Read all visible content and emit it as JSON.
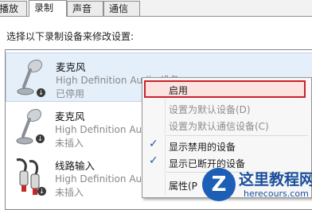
{
  "tabs": [
    {
      "label": "播放"
    },
    {
      "label": "录制"
    },
    {
      "label": "声音"
    },
    {
      "label": "通信"
    }
  ],
  "instruction": "选择以下录制设备来修改设置:",
  "devices": [
    {
      "name": "麦克风",
      "description": "High Definition Audio 设备",
      "status": "已停用",
      "icon": "microphone-icon"
    },
    {
      "name": "麦克风",
      "description": "High Definition Audio 设备",
      "status": "未插入",
      "icon": "microphone-icon"
    },
    {
      "name": "线路输入",
      "description": "High Definition Audio 设备",
      "status": "未插入",
      "icon": "line-in-cable-icon"
    }
  ],
  "context_menu": {
    "items": [
      {
        "label": "启用",
        "enabled": true,
        "highlighted": true
      },
      {
        "label": "设置为默认设备(D)",
        "enabled": false
      },
      {
        "label": "设置为默认通信设备(C)",
        "enabled": false
      },
      {
        "label": "显示禁用的设备",
        "checked": true
      },
      {
        "label": "显示已断开的设备",
        "checked": true
      },
      {
        "label": "属性(P"
      }
    ]
  },
  "watermark": {
    "title": "这里教程网",
    "url": "herecours.com"
  },
  "colors": {
    "highlight_border": "#c9222b",
    "selection": "#e5effa",
    "accent": "#1b4f9c"
  }
}
